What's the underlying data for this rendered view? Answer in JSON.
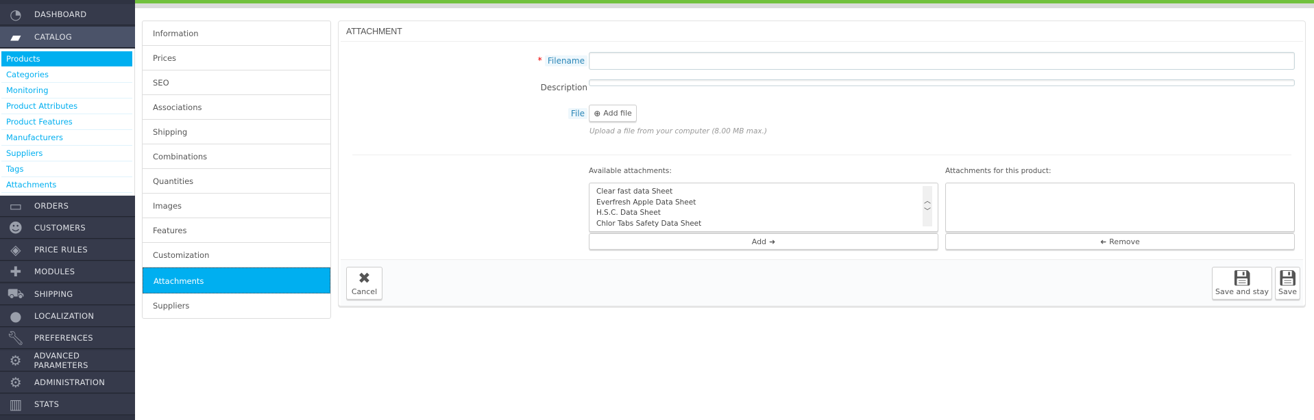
{
  "sidebar": {
    "top": [
      {
        "label": "DASHBOARD",
        "icon": "dashboard-icon"
      },
      {
        "label": "CATALOG",
        "icon": "book-icon"
      }
    ],
    "catalog_items": [
      "Products",
      "Categories",
      "Monitoring",
      "Product Attributes",
      "Product Features",
      "Manufacturers",
      "Suppliers",
      "Tags",
      "Attachments"
    ],
    "bottom": [
      {
        "label": "ORDERS",
        "icon": "credit-card-icon"
      },
      {
        "label": "CUSTOMERS",
        "icon": "users-icon"
      },
      {
        "label": "PRICE RULES",
        "icon": "tags-icon"
      },
      {
        "label": "MODULES",
        "icon": "puzzle-icon"
      },
      {
        "label": "SHIPPING",
        "icon": "truck-icon"
      },
      {
        "label": "LOCALIZATION",
        "icon": "globe-icon"
      },
      {
        "label": "PREFERENCES",
        "icon": "wrench-icon"
      },
      {
        "label": "ADVANCED PARAMETERS",
        "icon": "cogs-icon"
      },
      {
        "label": "ADMINISTRATION",
        "icon": "cog-icon"
      },
      {
        "label": "STATS",
        "icon": "bar-chart-icon"
      }
    ]
  },
  "tabs": [
    "Information",
    "Prices",
    "SEO",
    "Associations",
    "Shipping",
    "Combinations",
    "Quantities",
    "Images",
    "Features",
    "Customization",
    "Attachments",
    "Suppliers"
  ],
  "active_tab": "Attachments",
  "panel": {
    "title": "ATTACHMENT",
    "required_mark": "*",
    "filename_label": "Filename",
    "filename_value": "",
    "description_label": "Description",
    "description_value": "",
    "file_label": "File",
    "add_file": "Add file",
    "help": "Upload a file from your computer (8.00 MB max.)",
    "available_label": "Available attachments:",
    "available": [
      "Clear fast data Sheet",
      "Everfresh Apple Data Sheet",
      "H.S.C. Data Sheet",
      "Chlor Tabs Safety Data Sheet"
    ],
    "assigned_label": "Attachments for this product:",
    "assigned": [],
    "add": "Add",
    "remove": "Remove",
    "cancel": "Cancel",
    "save_stay": "Save and stay",
    "save": "Save"
  },
  "colors": {
    "accent": "#00aff0",
    "sidebar": "#363a4b",
    "topbar": "#72c13e"
  }
}
